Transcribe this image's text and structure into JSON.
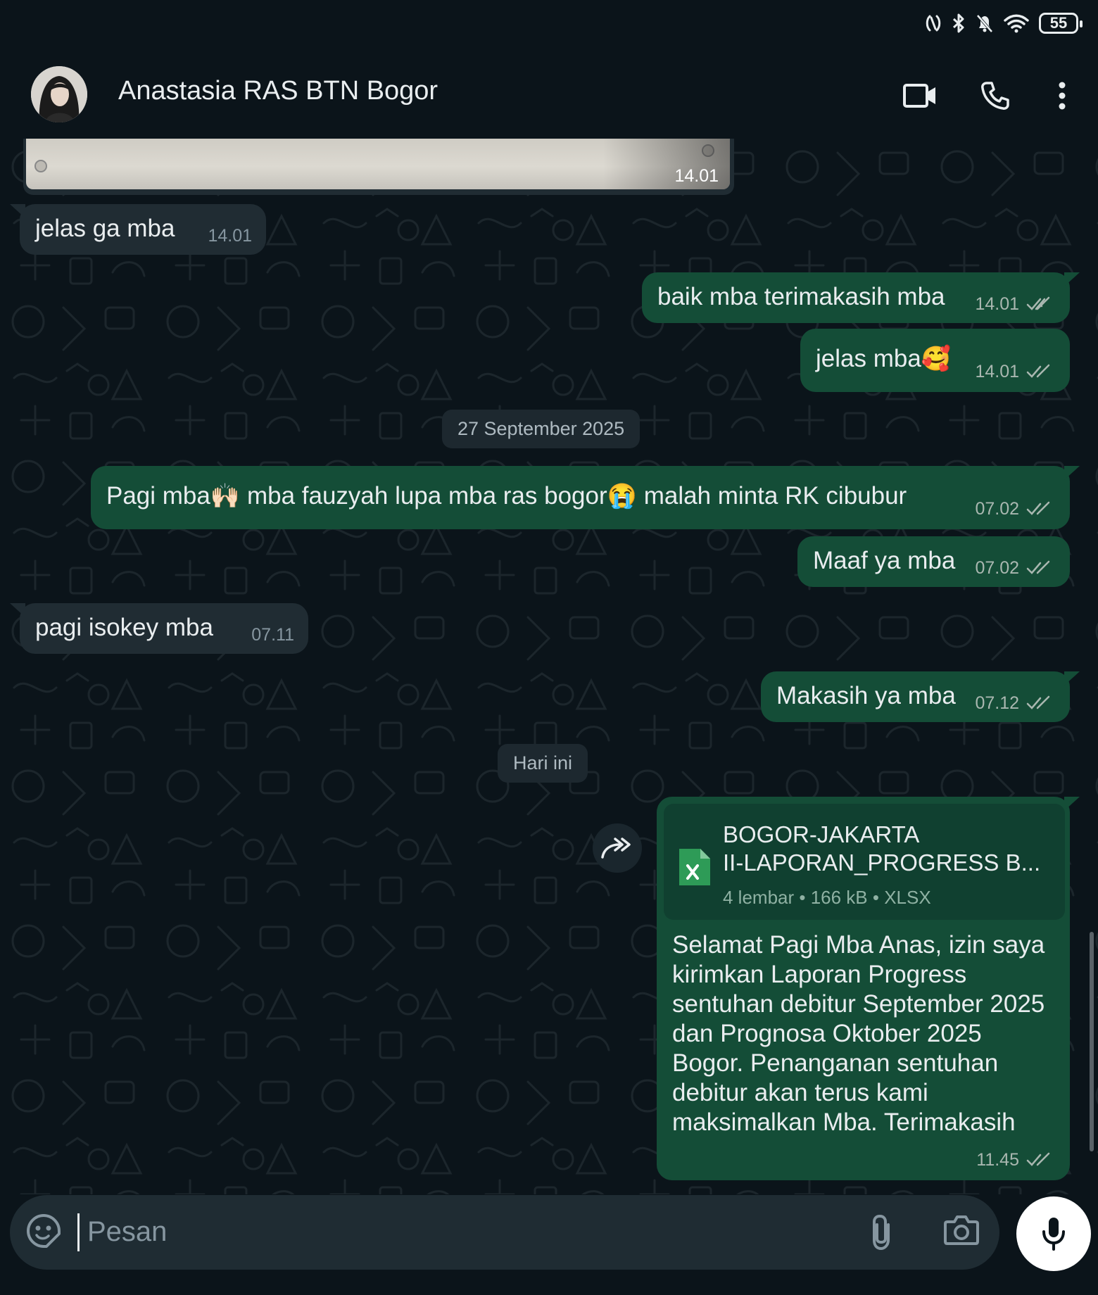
{
  "status_bar": {
    "battery": "55",
    "icons": [
      "nfc-icon",
      "bluetooth-icon",
      "bell-off-icon",
      "wifi-icon",
      "battery-icon"
    ]
  },
  "header": {
    "contact_name": "Anastasia RAS BTN Bogor",
    "icons": [
      "video-call-icon",
      "voice-call-icon",
      "more-options-icon"
    ]
  },
  "colors": {
    "background": "#0b141a",
    "outgoing_bubble": "#144d37",
    "incoming_bubble": "#202c33",
    "header": "#0b141a"
  },
  "image_message": {
    "time": "14.01"
  },
  "messages": [
    {
      "dir": "in",
      "text": "jelas ga mba",
      "time": "14.01"
    },
    {
      "dir": "out",
      "text": "baik mba terimakasih mba",
      "time": "14.01"
    },
    {
      "dir": "out",
      "text": "jelas mba",
      "emoji": "🥰",
      "time": "14.01"
    },
    {
      "dir": "out",
      "text_parts": [
        "Pagi mba",
        "🙌🏻",
        " mba fauzyah lupa mba ras bogor",
        "😭",
        " malah minta RK cibubur"
      ],
      "time": "07.02"
    },
    {
      "dir": "out",
      "text": "Maaf ya mba",
      "time": "07.02"
    },
    {
      "dir": "in",
      "text": "pagi isokey mba",
      "time": "07.11"
    },
    {
      "dir": "out",
      "text": "Makasih ya mba",
      "time": "07.12"
    }
  ],
  "date_chips": [
    "27 September 2025",
    "Hari ini"
  ],
  "document_message": {
    "file_title_line1": "BOGOR-JAKARTA",
    "file_title_line2": "II-LAPORAN_PROGRESS B...",
    "file_meta": "4 lembar  •  166 kB  •  XLSX",
    "file_icon": "xlsx-icon",
    "caption": "Selamat Pagi Mba Anas, izin saya kirimkan Laporan Progress sentuhan debitur September 2025 dan Prognosa Oktober 2025 Bogor. Penanganan sentuhan debitur akan terus kami maksimalkan Mba. Terimakasih",
    "time": "11.45"
  },
  "input": {
    "placeholder": "Pesan"
  }
}
